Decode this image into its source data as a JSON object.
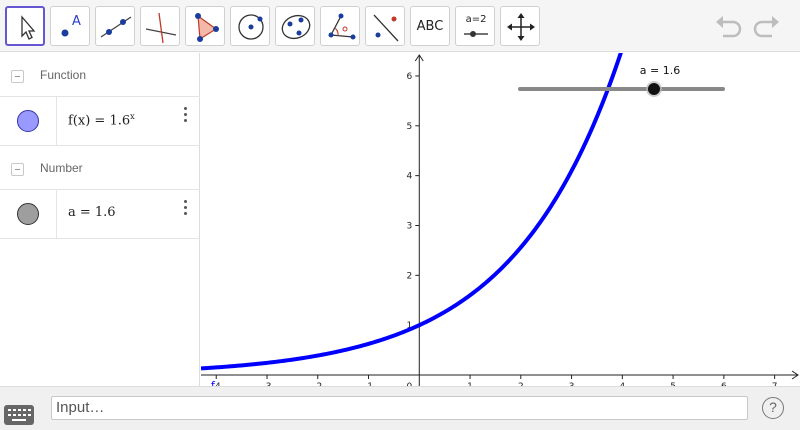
{
  "toolbar": {
    "tools": [
      {
        "icon": "move-arrow-icon",
        "active": true
      },
      {
        "icon": "point-icon",
        "label": "A"
      },
      {
        "icon": "line-icon"
      },
      {
        "icon": "perpendicular-line-icon"
      },
      {
        "icon": "polygon-icon"
      },
      {
        "icon": "circle-center-point-icon"
      },
      {
        "icon": "conic-ellipse-icon"
      },
      {
        "icon": "angle-icon"
      },
      {
        "icon": "reflect-icon"
      },
      {
        "icon": "text-icon",
        "label": "ABC"
      },
      {
        "icon": "slider-icon",
        "label": "a=2"
      },
      {
        "icon": "move-graphics-view-icon"
      }
    ],
    "undo_icon": "undo-icon",
    "redo_icon": "redo-icon"
  },
  "algebra": {
    "groups": [
      {
        "label": "Function",
        "item": {
          "text": "f(x) = 1.6",
          "exponent": "x",
          "marble_color": "#9999ff"
        }
      },
      {
        "label": "Number",
        "item": {
          "text": "a = 1.6",
          "marble_color": "#9e9e9e"
        }
      }
    ]
  },
  "graphics": {
    "curve_color": "#0000ff",
    "curve_label": "f",
    "slider": {
      "label": "a = 1.6",
      "value": 1.6,
      "min": -5,
      "max": 5
    }
  },
  "chart_data": {
    "type": "line",
    "function": "1.6^x",
    "x_range": [
      -4.3,
      7.5
    ],
    "y_range": [
      -0.1,
      6.3
    ],
    "x_ticks": [
      "-4",
      "-3",
      "-2",
      "-1",
      "1",
      "2",
      "3",
      "4",
      "5",
      "6",
      "7"
    ],
    "y_ticks": [
      "1",
      "2",
      "3",
      "4",
      "5",
      "6"
    ],
    "origin_label": "0",
    "series": [
      {
        "name": "f",
        "x": [
          -4.3,
          -3,
          -2,
          -1,
          0,
          1,
          2,
          3,
          3.77
        ],
        "y": [
          0.13,
          0.24,
          0.39,
          0.63,
          1,
          1.6,
          2.56,
          4.1,
          5.9
        ]
      }
    ]
  },
  "inputbar": {
    "placeholder": "Input…",
    "help": "?"
  }
}
